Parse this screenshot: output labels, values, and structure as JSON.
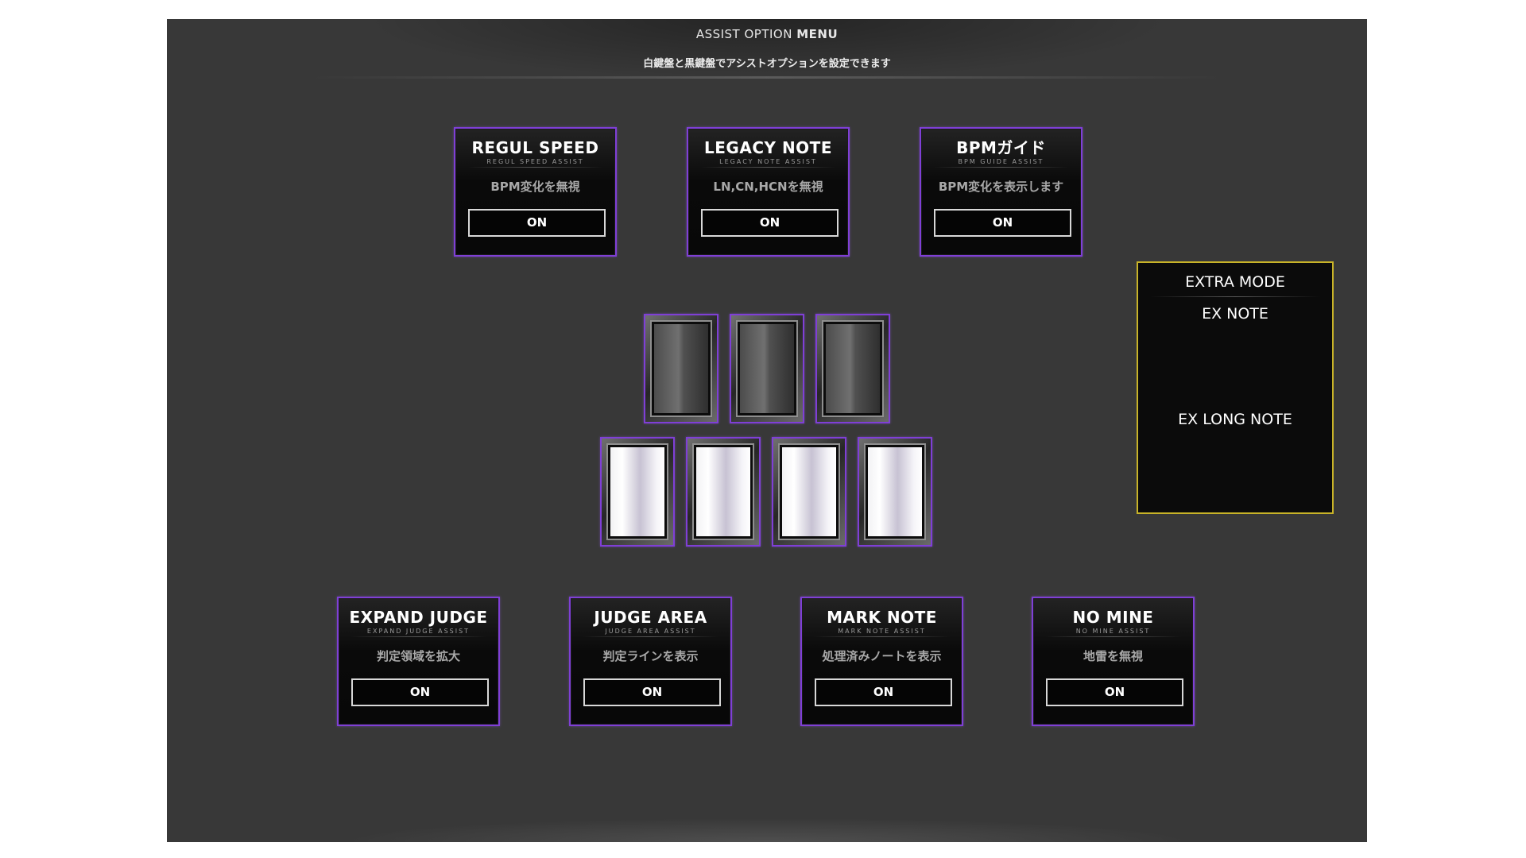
{
  "menu": {
    "title_prefix": "ASSIST OPTION",
    "title_bold": "MENU",
    "subtitle": "白鍵盤と黒鍵盤でアシストオプションを設定できます"
  },
  "top_options": [
    {
      "title": "REGUL SPEED",
      "sub": "REGUL SPEED ASSIST",
      "desc": "BPM変化を無視",
      "value": "ON"
    },
    {
      "title": "LEGACY NOTE",
      "sub": "LEGACY NOTE ASSIST",
      "desc": "LN,CN,HCNを無視",
      "value": "ON"
    },
    {
      "title": "BPMガイド",
      "sub": "BPM GUIDE ASSIST",
      "desc": "BPM変化を表示します",
      "value": "ON"
    }
  ],
  "bottom_options": [
    {
      "title": "EXPAND JUDGE",
      "sub": "EXPAND JUDGE ASSIST",
      "desc": "判定領域を拡大",
      "value": "ON"
    },
    {
      "title": "JUDGE AREA",
      "sub": "JUDGE AREA ASSIST",
      "desc": "判定ラインを表示",
      "value": "ON"
    },
    {
      "title": "MARK NOTE",
      "sub": "MARK NOTE ASSIST",
      "desc": "処理済みノートを表示",
      "value": "ON"
    },
    {
      "title": "NO MINE",
      "sub": "NO MINE ASSIST",
      "desc": "地雷を無視",
      "value": "ON"
    }
  ],
  "extra_mode": {
    "title": "EXTRA MODE",
    "options": [
      "EX NOTE",
      "EX LONG NOTE"
    ]
  },
  "colors": {
    "card_border": "#7f3fd6",
    "extra_border": "#c8b328",
    "background": "#383838"
  }
}
